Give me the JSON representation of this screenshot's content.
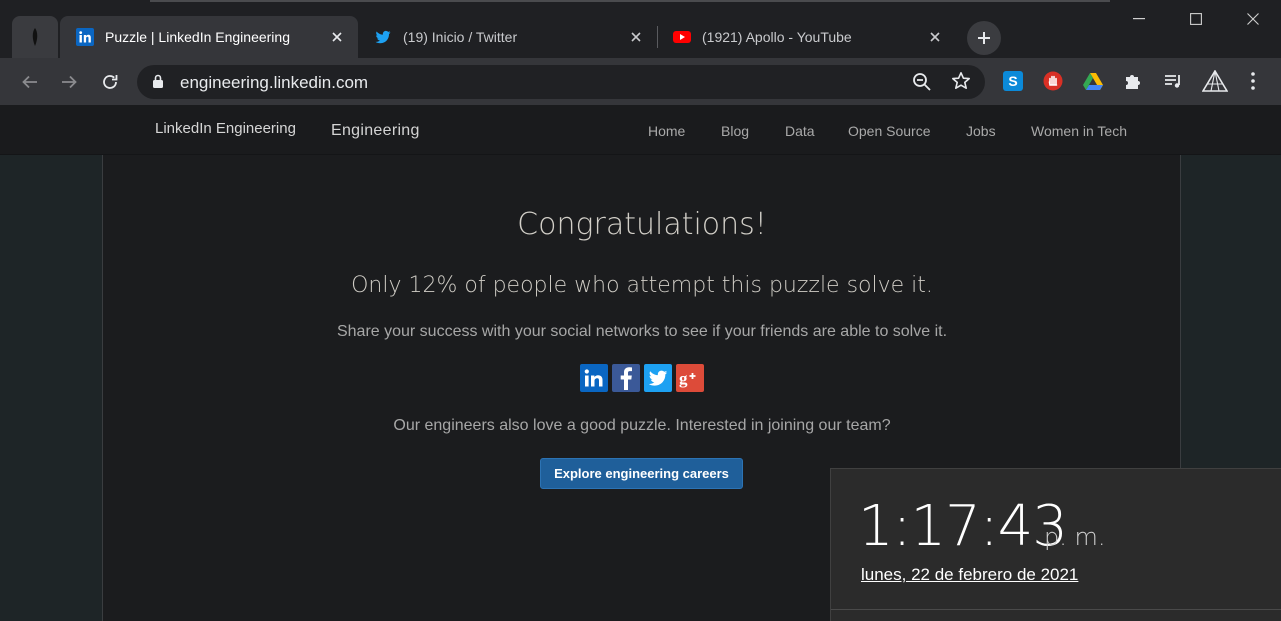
{
  "browser": {
    "tabs": [
      {
        "title": "Puzzle | LinkedIn Engineering",
        "favicon": "linkedin-icon",
        "active": true
      },
      {
        "title": "(19) Inicio / Twitter",
        "favicon": "twitter-icon",
        "active": false
      },
      {
        "title": "(1921) Apollo - YouTube",
        "favicon": "youtube-icon",
        "active": false
      }
    ],
    "url": "engineering.linkedin.com",
    "extensions": [
      "skype-icon",
      "stop-hand-icon",
      "google-drive-icon",
      "puzzle-extensions-icon",
      "media-queue-icon",
      "prism-icon"
    ]
  },
  "site": {
    "brand_alt": "LinkedIn Engineering",
    "brand_text": "Engineering",
    "nav": [
      "Home",
      "Blog",
      "Data",
      "Open Source",
      "Jobs",
      "Women in Tech"
    ]
  },
  "main": {
    "heading": "Congratulations!",
    "stat": "Only 12% of people who attempt this puzzle solve it.",
    "share_text": "Share your success with your social networks to see if your friends are able to solve it.",
    "social": [
      "linkedin",
      "facebook",
      "twitter",
      "google-plus"
    ],
    "engineers_text": "Our engineers also love a good puzzle. Interested in joining our team?",
    "careers_button": "Explore engineering careers"
  },
  "clock": {
    "time": "1:17:43",
    "ampm": "p. m.",
    "date": "lunes, 22 de febrero de 2021"
  },
  "colors": {
    "linkedin": "#0a66c2",
    "facebook": "#3b5998",
    "twitter": "#1da1f2",
    "google_plus": "#dd4b39",
    "youtube": "#ff0000",
    "button": "#1f5f9a"
  }
}
